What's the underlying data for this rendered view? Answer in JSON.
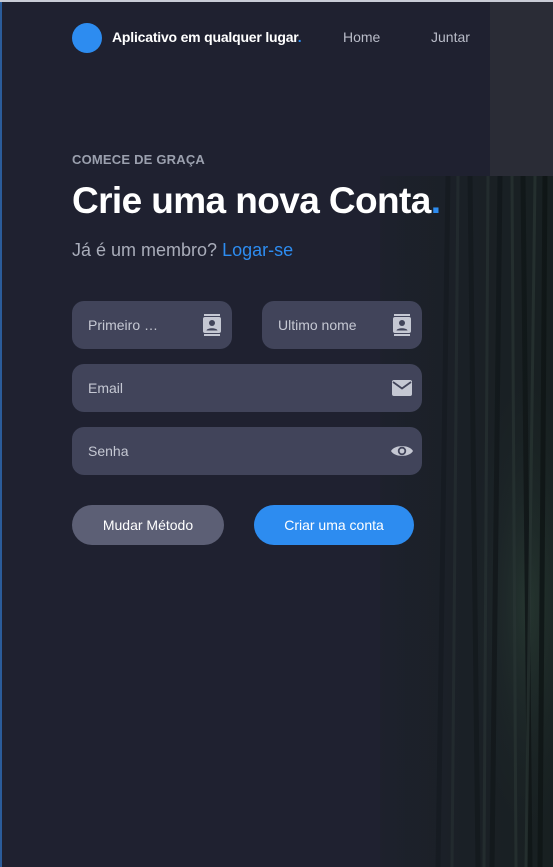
{
  "nav": {
    "brand": "Aplicativo em qualquer lugar",
    "brand_dot": ".",
    "links": [
      {
        "label": "Home"
      },
      {
        "label": "Juntar"
      }
    ]
  },
  "hero": {
    "eyebrow": "COMECE DE GRAÇA",
    "title": "Crie uma nova Conta",
    "title_dot": ".",
    "member_text": "Já é um membro?",
    "login_link": "Logar-se"
  },
  "form": {
    "first_name": {
      "placeholder": "Primeiro …",
      "value": "",
      "icon": "contact-card-icon"
    },
    "last_name": {
      "placeholder": "Ultimo nome",
      "value": "",
      "icon": "contact-card-icon"
    },
    "email": {
      "placeholder": "Email",
      "value": "",
      "icon": "envelope-icon"
    },
    "password": {
      "placeholder": "Senha",
      "value": "",
      "icon": "eye-icon"
    }
  },
  "buttons": {
    "change_method": "Mudar Método",
    "create_account": "Criar uma conta"
  },
  "colors": {
    "accent": "#2d8cf0",
    "background": "#1f2130",
    "field": "#41445a",
    "secondary_button": "#5c5f75"
  }
}
